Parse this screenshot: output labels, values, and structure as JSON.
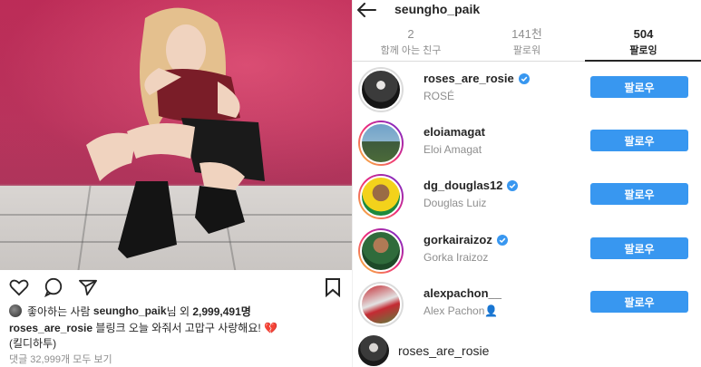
{
  "post": {
    "likes": {
      "prefix": "좋아하는 사람",
      "liker": "seungho_paik",
      "middle": "님 외",
      "count": "2,999,491명"
    },
    "caption": {
      "author": "roses_are_rosie",
      "text": "블링크 오늘 와줘서 고맙구 사랑해요!",
      "emoji": "💔",
      "line2": "(킬디하투)"
    },
    "comments_link": "댓글 32,999개 모두 보기",
    "icons": [
      "heart-icon",
      "comment-icon",
      "share-icon",
      "bookmark-icon"
    ]
  },
  "panel": {
    "header": {
      "username": "seungho_paik",
      "back_icon": "back-arrow-icon"
    },
    "tabs": [
      {
        "num": "2",
        "label": "함께 아는 친구",
        "active": false
      },
      {
        "num": "141천",
        "label": "팔로워",
        "active": false
      },
      {
        "num": "504",
        "label": "팔로잉",
        "active": true
      }
    ],
    "rows": [
      {
        "handle": "roses_are_rosie",
        "name": "ROSÉ",
        "verified": true,
        "button": "팔로우"
      },
      {
        "handle": "eloiamagat",
        "name": "Eloi Amagat",
        "verified": false,
        "button": "팔로우"
      },
      {
        "handle": "dg_douglas12",
        "name": "Douglas Luiz",
        "verified": true,
        "button": "팔로우"
      },
      {
        "handle": "gorkairaizoz",
        "name": "Gorka Iraizoz",
        "verified": true,
        "button": "팔로우"
      },
      {
        "handle": "alexpachon__",
        "name": "Alex Pachon👤",
        "verified": false,
        "button": "팔로우"
      }
    ],
    "bottom_row": {
      "handle": "roses_are_rosie"
    }
  },
  "colors": {
    "accent_blue": "#3897f0",
    "verified_blue": "#3897f0",
    "text_primary": "#262626",
    "text_secondary": "#8e8e8e",
    "wall_pink": "#c8325e"
  }
}
